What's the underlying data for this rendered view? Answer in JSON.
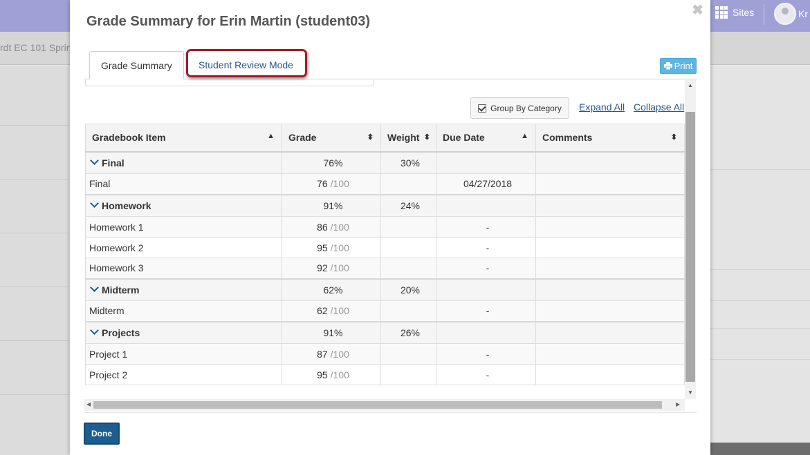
{
  "background": {
    "site_title": "rdt EC 101 Sprin",
    "sites_label": "Sites",
    "user_label": "Kr"
  },
  "modal": {
    "title": "Grade Summary for Erin Martin (student03)",
    "close_symbol": "✖",
    "tabs": [
      {
        "label": "Grade Summary",
        "active": true
      },
      {
        "label": "Student Review Mode",
        "active": false,
        "highlighted": true
      }
    ],
    "print_label": "Print",
    "group_by_label": "Group By Category",
    "group_by_checked": true,
    "expand_all": "Expand All",
    "collapse_all": "Collapse All",
    "done_label": "Done",
    "highlight_color": "#a01e25",
    "accent_color": "#1d5d8f",
    "link_color": "#24578a"
  },
  "table": {
    "columns": [
      "Gradebook Item",
      "Grade",
      "Weight",
      "Due Date",
      "Comments"
    ],
    "categories": [
      {
        "name": "Final",
        "grade": "76%",
        "weight": "30%",
        "items": [
          {
            "name": "Final",
            "score": "76",
            "max": "/100",
            "due": "04/27/2018"
          }
        ]
      },
      {
        "name": "Homework",
        "grade": "91%",
        "weight": "24%",
        "items": [
          {
            "name": "Homework 1",
            "score": "86",
            "max": "/100",
            "due": "-"
          },
          {
            "name": "Homework 2",
            "score": "95",
            "max": "/100",
            "due": "-"
          },
          {
            "name": "Homework 3",
            "score": "92",
            "max": "/100",
            "due": "-"
          }
        ]
      },
      {
        "name": "Midterm",
        "grade": "62%",
        "weight": "20%",
        "items": [
          {
            "name": "Midterm",
            "score": "62",
            "max": "/100",
            "due": "-"
          }
        ]
      },
      {
        "name": "Projects",
        "grade": "91%",
        "weight": "26%",
        "items": [
          {
            "name": "Project 1",
            "score": "87",
            "max": "/100",
            "due": "-"
          },
          {
            "name": "Project 2",
            "score": "95",
            "max": "/100",
            "due": "-"
          }
        ]
      }
    ]
  }
}
